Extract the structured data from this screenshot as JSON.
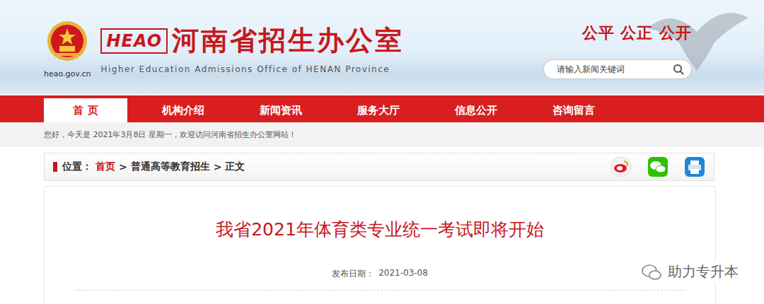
{
  "site": {
    "emblem_label": "heao.gov.cn",
    "logo_mark": "HEAO",
    "title": "河南省招生办公室",
    "subtitle": "Higher Education Admissions Office of HENAN Province",
    "slogan": "公平 公正 公开"
  },
  "search": {
    "placeholder": "请输入新闻关键词"
  },
  "nav": [
    {
      "label": "首 页",
      "selected": true
    },
    {
      "label": "机构介绍",
      "selected": false
    },
    {
      "label": "新闻资讯",
      "selected": false
    },
    {
      "label": "服务大厅",
      "selected": false
    },
    {
      "label": "信息公开",
      "selected": false
    },
    {
      "label": "咨询留言",
      "selected": false
    }
  ],
  "greeting": "您好，今天是 2021年3月8日 星期一，欢迎访问河南省招生办公室网站！",
  "breadcrumb": {
    "label": "位置：",
    "separator": ">",
    "items": [
      "首页",
      "普通高等教育招生",
      "正文"
    ]
  },
  "article": {
    "title": "我省2021年体育类专业统一考试即将开始",
    "date_label": "发布日期：",
    "date": "2021-03-08"
  },
  "watermark": "助力专升本"
}
